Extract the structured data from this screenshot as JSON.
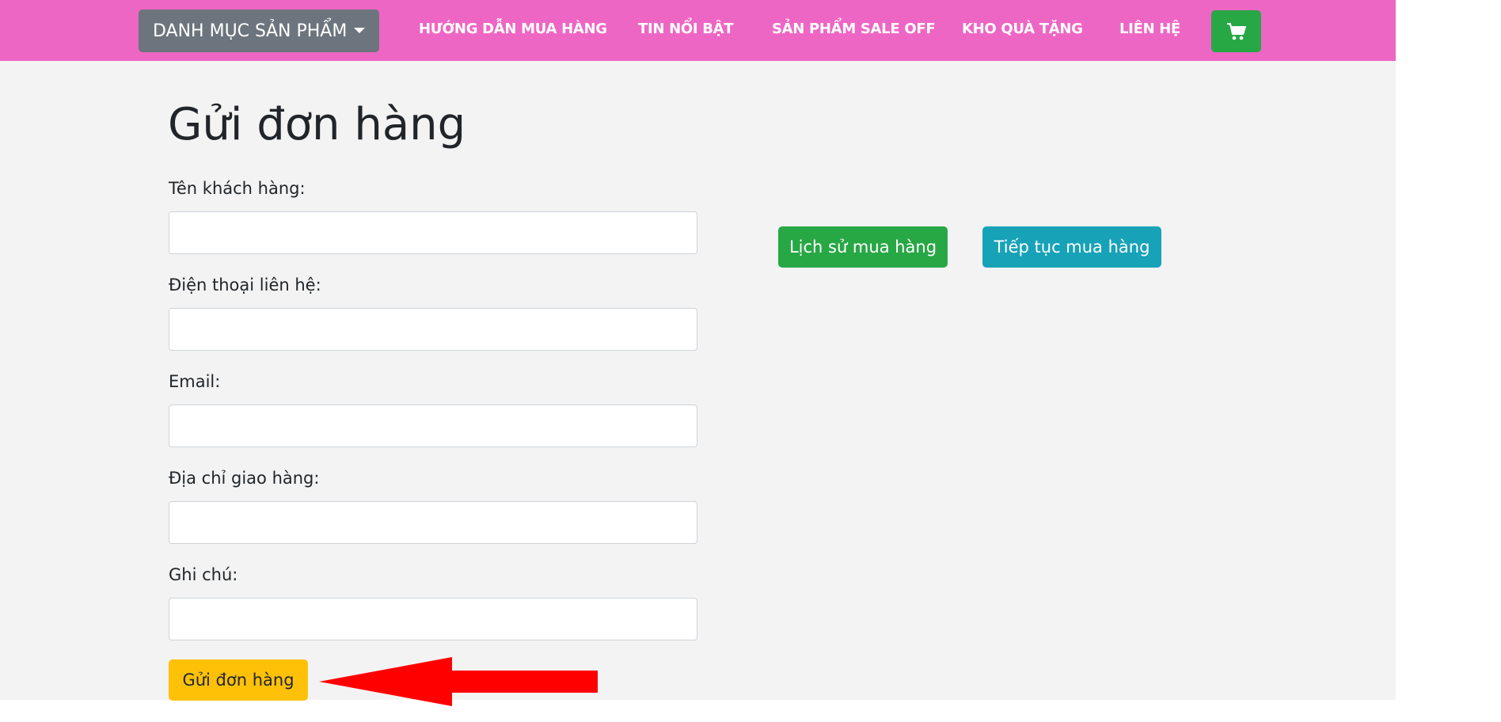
{
  "navbar": {
    "category_dropdown": "DANH MỤC SẢN PHẨM",
    "links": [
      "HƯỚNG DẪN MUA HÀNG",
      "TIN NỔI BẬT",
      "SẢN PHẨM SALE OFF",
      "KHO QUÀ TẶNG",
      "LIÊN HỆ"
    ],
    "cart_icon": "shopping-cart-icon"
  },
  "form": {
    "title": "Gửi đơn hàng",
    "fields": [
      {
        "label": "Tên khách hàng:",
        "value": ""
      },
      {
        "label": "Điện thoại liên hệ:",
        "value": ""
      },
      {
        "label": "Email:",
        "value": ""
      },
      {
        "label": "Địa chỉ giao hàng:",
        "value": ""
      },
      {
        "label": "Ghi chú:",
        "value": ""
      }
    ],
    "submit_label": "Gửi đơn hàng"
  },
  "actions": {
    "history_label": "Lịch sử mua hàng",
    "continue_label": "Tiếp tục mua hàng"
  },
  "colors": {
    "navbar": "#ee66c4",
    "dropdown": "#6c757d",
    "cart": "#28a745",
    "history": "#28a745",
    "continue": "#17a2b8",
    "submit": "#ffc107",
    "annotation_arrow": "#ff0000"
  }
}
